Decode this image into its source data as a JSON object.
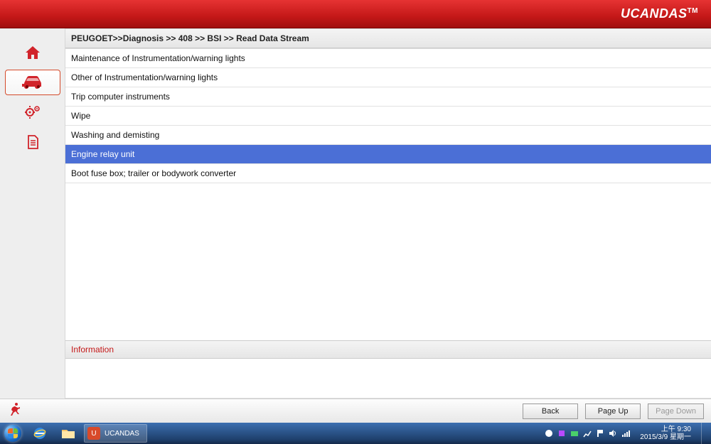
{
  "brand": {
    "name": "UCANDAS",
    "tm": "TM"
  },
  "breadcrumb": "PEUGOET>>Diagnosis >> 408 >> BSI >> Read Data Stream",
  "sidebar": {
    "items": [
      {
        "name": "home-icon"
      },
      {
        "name": "car-icon",
        "active": true
      },
      {
        "name": "gears-icon"
      },
      {
        "name": "document-icon"
      }
    ]
  },
  "list": {
    "items": [
      {
        "label": "Maintenance of Instrumentation/warning lights",
        "selected": false
      },
      {
        "label": "Other of Instrumentation/warning lights",
        "selected": false
      },
      {
        "label": "Trip computer instruments",
        "selected": false
      },
      {
        "label": "Wipe",
        "selected": false
      },
      {
        "label": "Washing and demisting",
        "selected": false
      },
      {
        "label": "Engine relay unit",
        "selected": true
      },
      {
        "label": "Boot fuse box; trailer or bodywork converter",
        "selected": false
      }
    ]
  },
  "info_header": "Information",
  "buttons": {
    "back": "Back",
    "page_up": "Page Up",
    "page_down": "Page  Down"
  },
  "taskbar": {
    "task_label": "UCANDAS",
    "clock_line1": "上午 9:30",
    "clock_line2": "2015/3/9 星期一"
  }
}
